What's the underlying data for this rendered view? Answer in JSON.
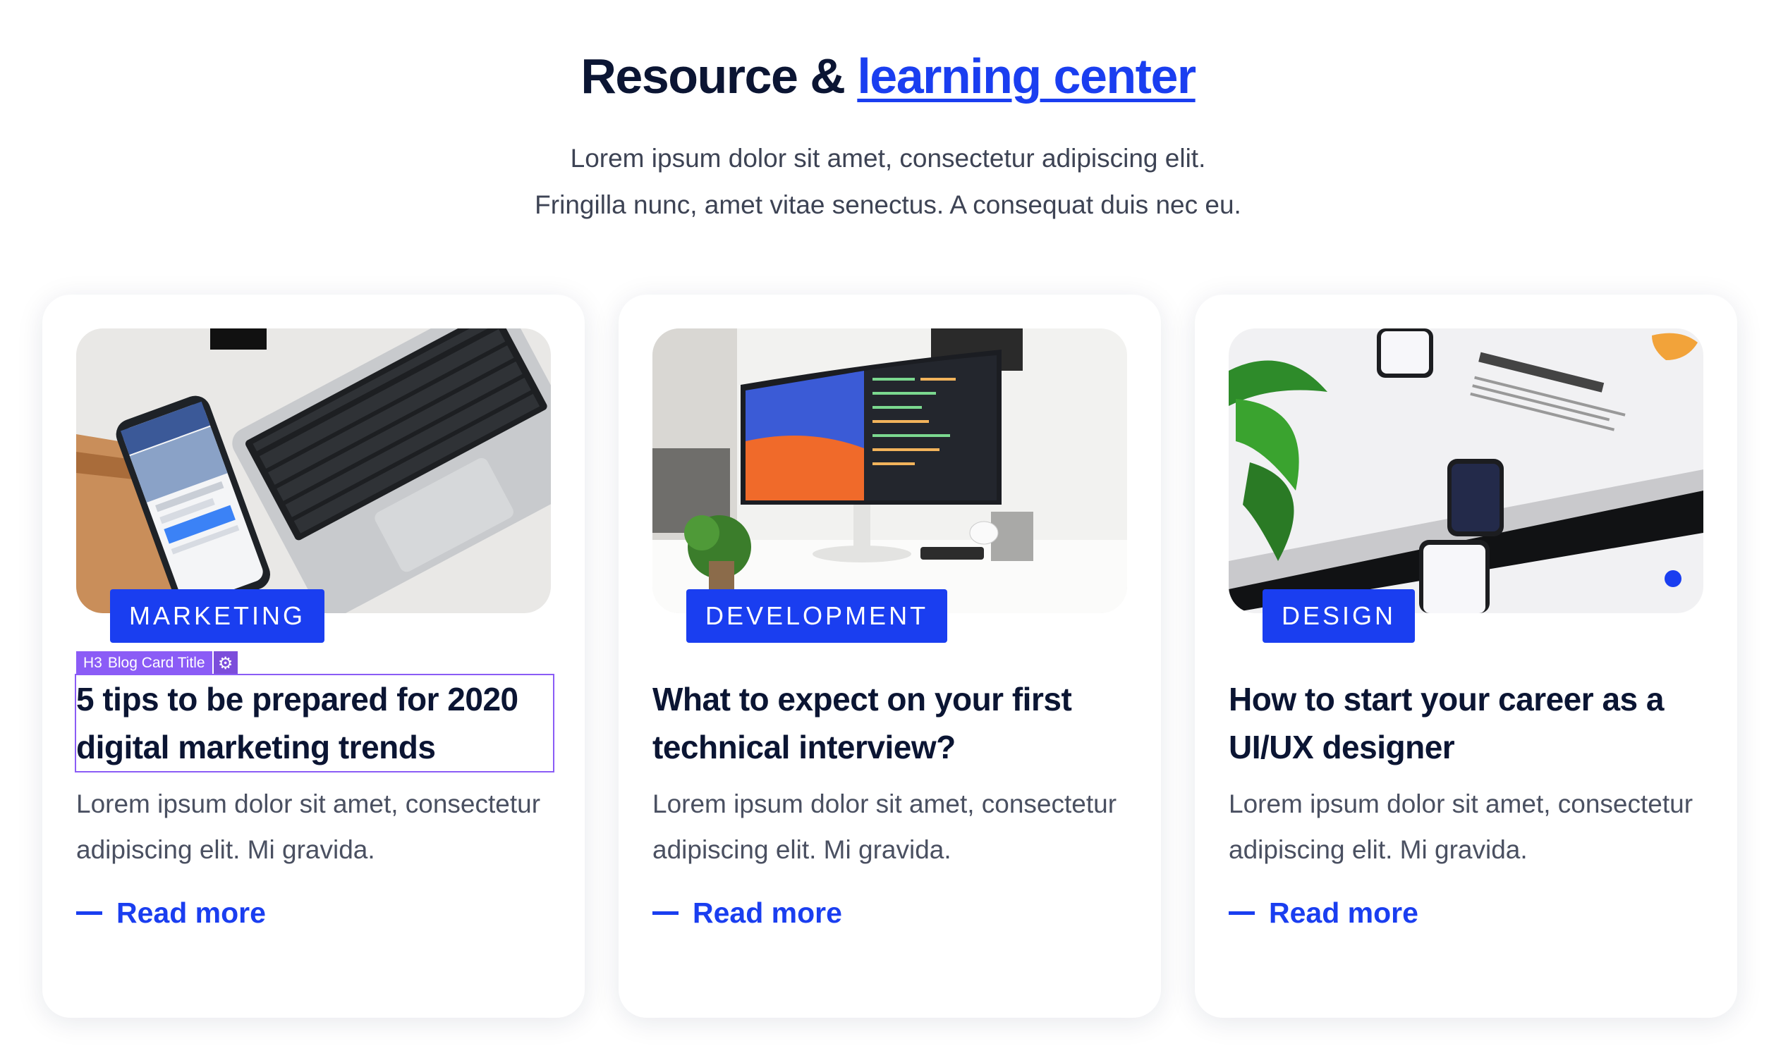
{
  "header": {
    "title_prefix": "Resource & ",
    "title_link": "learning center",
    "subtitle_line1": "Lorem ipsum dolor sit amet, consectetur adipiscing elit.",
    "subtitle_line2": "Fringilla nunc, amet vitae senectus. A consequat duis nec eu."
  },
  "accent_color": "#1a3ef0",
  "editor_tag": {
    "heading_level": "H3",
    "label": "Blog Card Title",
    "icon": "gear-icon"
  },
  "cards": [
    {
      "category": "MARKETING",
      "title": "5 tips to be prepared for 2020 digital marketing trends",
      "description": "Lorem ipsum dolor sit amet, consectetur adipiscing elit. Mi gravida.",
      "cta": "Read more",
      "image": "laptop-and-phone-photo"
    },
    {
      "category": "DEVELOPMENT",
      "title": "What to expect on your first technical interview?",
      "description": "Lorem ipsum dolor sit amet, consectetur adipiscing elit. Mi gravida.",
      "cta": "Read more",
      "image": "desk-monitor-photo"
    },
    {
      "category": "DESIGN",
      "title": "How to start your career as a UI/UX designer",
      "description": "Lorem ipsum dolor sit amet, consectetur adipiscing elit. Mi gravida.",
      "cta": "Read more",
      "image": "dashboard-mockup-photo"
    }
  ]
}
